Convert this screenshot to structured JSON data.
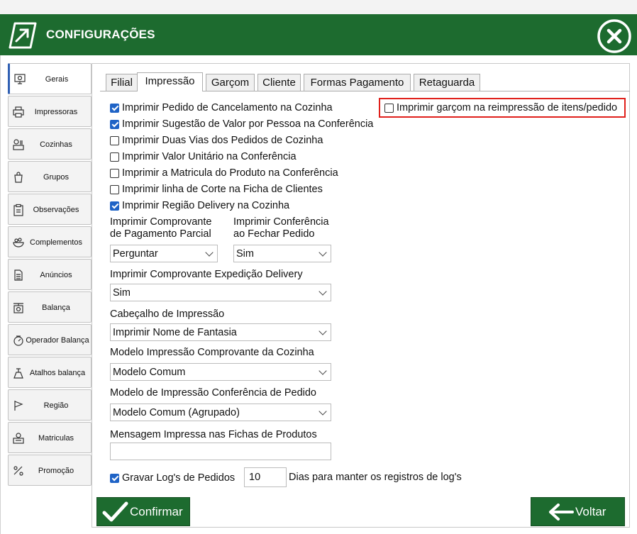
{
  "window": {
    "title": "CONFIGURAÇÕES"
  },
  "sidebar": {
    "items": [
      {
        "label": "Gerais",
        "icon": "gear-monitor-icon"
      },
      {
        "label": "Impressoras",
        "icon": "printer-icon"
      },
      {
        "label": "Cozinhas",
        "icon": "cooking-icon"
      },
      {
        "label": "Grupos",
        "icon": "bag-icon"
      },
      {
        "label": "Observações",
        "icon": "clipboard-icon"
      },
      {
        "label": "Complementos",
        "icon": "bowl-icon"
      },
      {
        "label": "Anúncios",
        "icon": "document-icon"
      },
      {
        "label": "Balança",
        "icon": "scale-icon"
      },
      {
        "label": "Operador Balança",
        "icon": "operator-scale-icon"
      },
      {
        "label": "Atalhos balança",
        "icon": "shortcut-scale-icon"
      },
      {
        "label": "Região",
        "icon": "flag-icon"
      },
      {
        "label": "Matriculas",
        "icon": "id-icon"
      },
      {
        "label": "Promoção",
        "icon": "promo-icon"
      }
    ]
  },
  "tabs": [
    {
      "label": "Filial"
    },
    {
      "label": "Impressão"
    },
    {
      "label": "Garçom"
    },
    {
      "label": "Cliente"
    },
    {
      "label": "Formas Pagamento"
    },
    {
      "label": "Retaguarda"
    }
  ],
  "checks": [
    {
      "label": "Imprimir Pedido de Cancelamento na Cozinha",
      "checked": true
    },
    {
      "label": "Imprimir Sugestão de Valor por Pessoa na Conferência",
      "checked": true
    },
    {
      "label": "Imprimir Duas Vias dos Pedidos de Cozinha",
      "checked": false
    },
    {
      "label": "Imprimir Valor Unitário na Conferência",
      "checked": false
    },
    {
      "label": "Imprimir a Matricula do Produto na Conferência",
      "checked": false
    },
    {
      "label": "Imprimir linha de Corte na Ficha de Clientes",
      "checked": false
    },
    {
      "label": "Imprimir Região Delivery na Cozinha",
      "checked": true
    }
  ],
  "waiter_reprint": {
    "label": "Imprimir garçom na reimpressão de itens/pedido",
    "checked": false
  },
  "partial_payment": {
    "label_line1": "Imprimir Comprovante",
    "label_line2": "de Pagamento Parcial",
    "value": "Perguntar"
  },
  "close_conference": {
    "label_line1": "Imprimir Conferência",
    "label_line2": "ao Fechar Pedido",
    "value": "Sim"
  },
  "delivery_receipt": {
    "label": "Imprimir Comprovante Expedição Delivery",
    "value": "Sim"
  },
  "print_header": {
    "label": "Cabeçalho de Impressão",
    "value": "Imprimir Nome de Fantasia"
  },
  "kitchen_model": {
    "label": "Modelo Impressão Comprovante da Cozinha",
    "value": "Modelo Comum"
  },
  "conference_model": {
    "label": "Modelo de Impressão Conferência de Pedido",
    "value": "Modelo Comum (Agrupado)"
  },
  "product_message": {
    "label": "Mensagem Impressa nas Fichas de Produtos",
    "value": ""
  },
  "log": {
    "label": "Gravar Log's de Pedidos",
    "checked": true,
    "days": "10",
    "days_label": "Dias para manter os registros de log's"
  },
  "buttons": {
    "confirm": "Confirmar",
    "back": "Voltar"
  },
  "colors": {
    "brand_green": "#1d6b2f",
    "checkbox_blue": "#1f63c6",
    "highlight_red": "#e0201b"
  }
}
